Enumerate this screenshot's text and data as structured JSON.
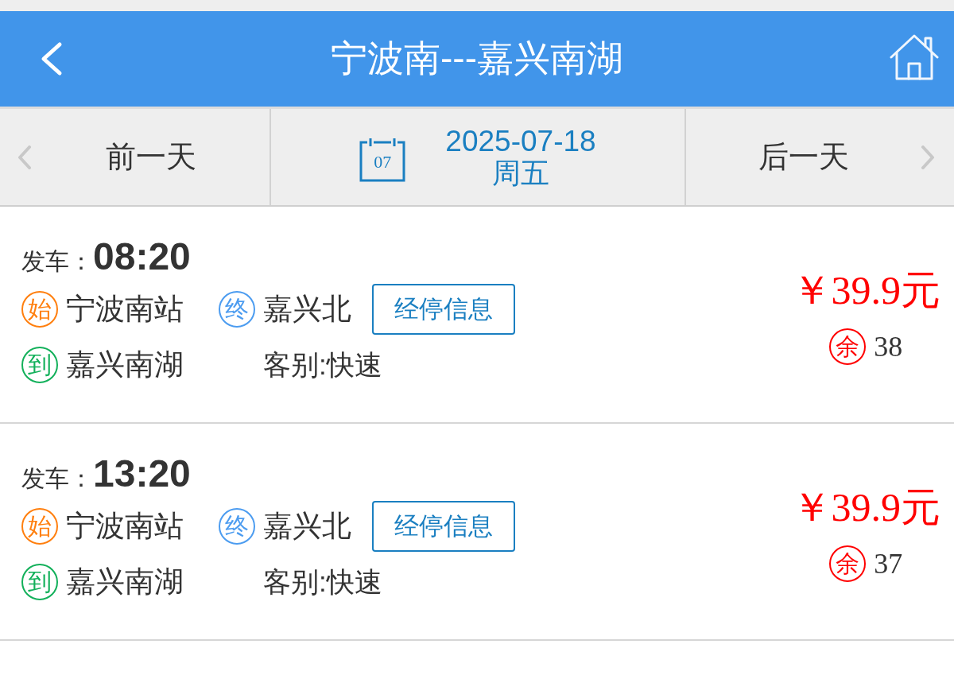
{
  "header": {
    "title": "宁波南---嘉兴南湖"
  },
  "date_bar": {
    "prev_label": "前一天",
    "calendar_day": "07",
    "date": "2025-07-18",
    "weekday": "周五",
    "next_label": "后一天"
  },
  "trains": [
    {
      "departure_label": "发车：",
      "departure_time": "08:20",
      "origin_badge": "始",
      "origin": "宁波南站",
      "terminal_badge": "终",
      "terminal": "嘉兴北",
      "stops_button": "经停信息",
      "arrival_badge": "到",
      "arrival": "嘉兴南湖",
      "service_type": "客别:快速",
      "price": "￥39.9元",
      "seats_badge": "余",
      "seats": "38"
    },
    {
      "departure_label": "发车：",
      "departure_time": "13:20",
      "origin_badge": "始",
      "origin": "宁波南站",
      "terminal_badge": "终",
      "terminal": "嘉兴北",
      "stops_button": "经停信息",
      "arrival_badge": "到",
      "arrival": "嘉兴南湖",
      "service_type": "客别:快速",
      "price": "￥39.9元",
      "seats_badge": "余",
      "seats": "37"
    }
  ]
}
